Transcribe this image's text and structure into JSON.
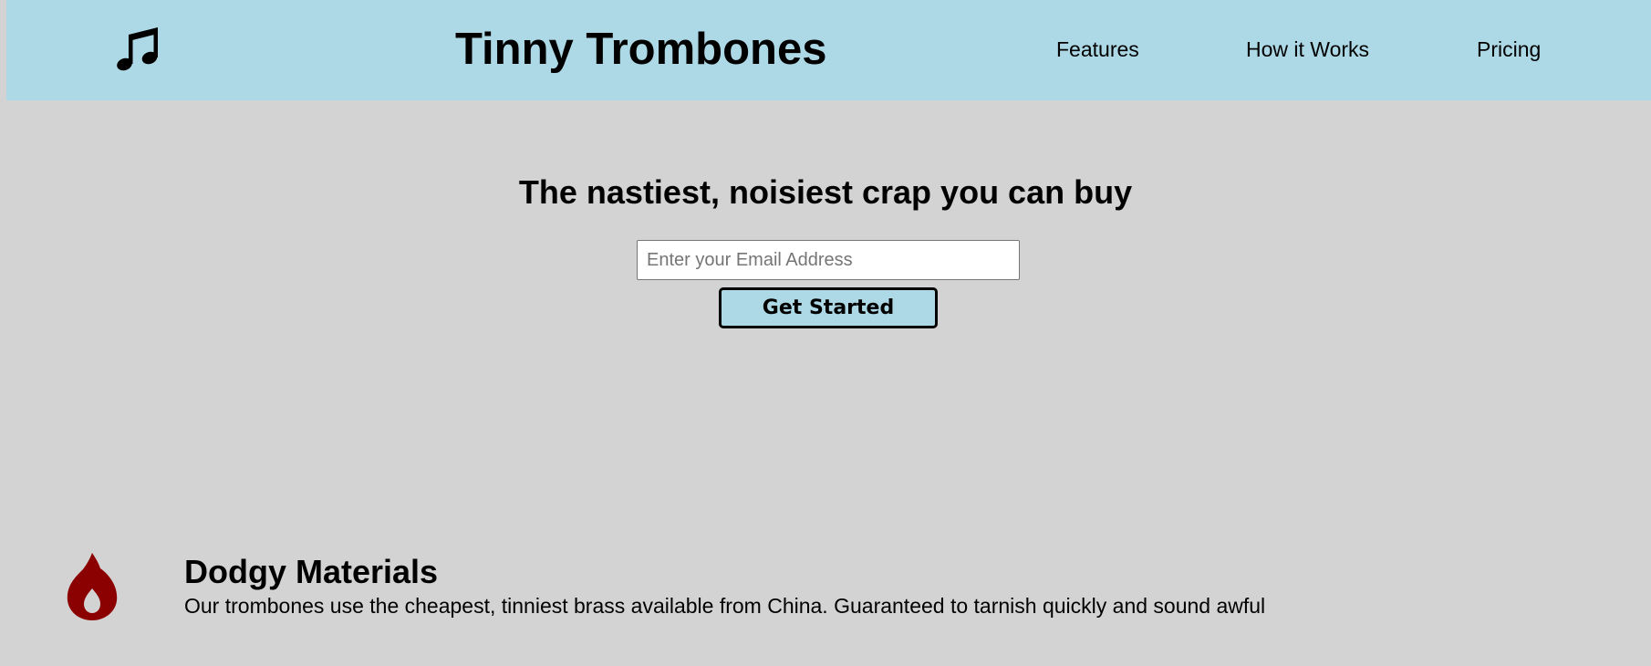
{
  "header": {
    "logo_icon": "music-note-icon",
    "title": "Tinny Trombones",
    "nav": [
      {
        "label": "Features"
      },
      {
        "label": "How it Works"
      },
      {
        "label": "Pricing"
      }
    ],
    "background_color": "#add8e6"
  },
  "hero": {
    "heading": "The nastiest, noisiest crap you can buy",
    "email_input": {
      "value": "",
      "placeholder": "Enter your Email Address"
    },
    "button_label": "Get Started"
  },
  "features": [
    {
      "icon": "fire-icon",
      "icon_color": "#8b0000",
      "title": "Dodgy Materials",
      "description": "Our trombones use the cheapest, tinniest brass available from China. Guaranteed to tarnish quickly and sound awful"
    }
  ],
  "page_background_color": "#d3d3d3"
}
